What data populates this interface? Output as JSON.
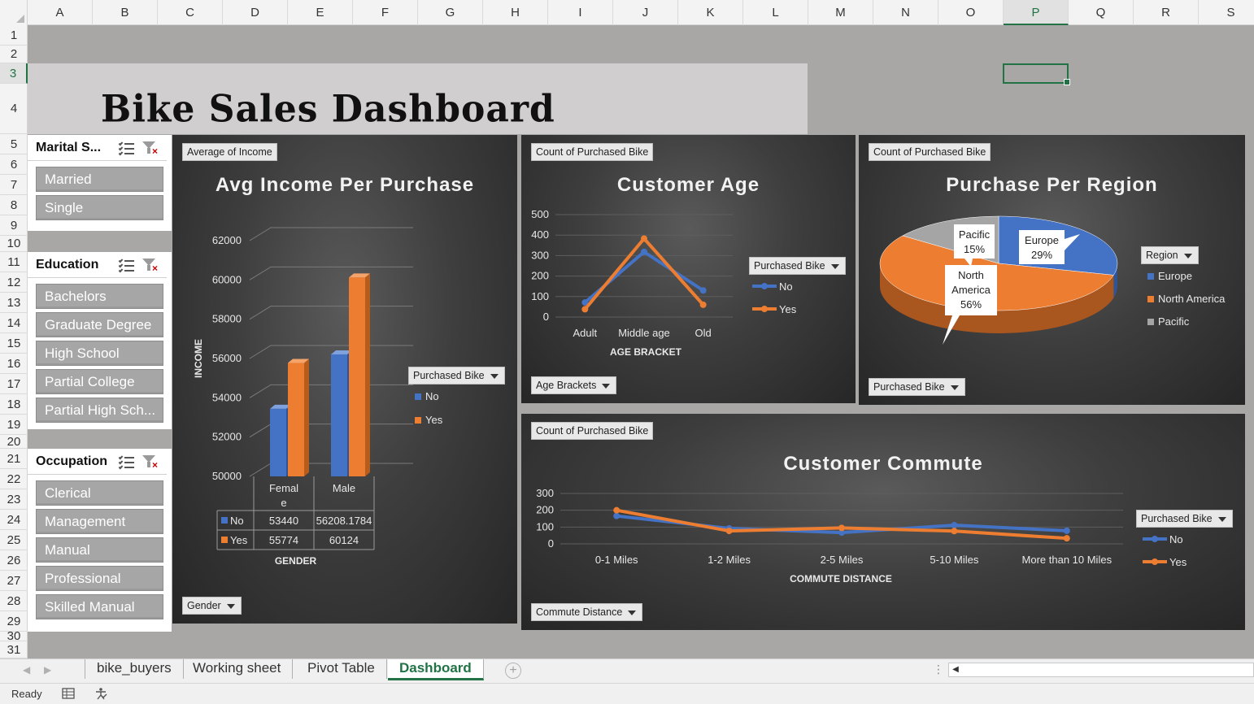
{
  "columns": [
    "A",
    "B",
    "C",
    "D",
    "E",
    "F",
    "G",
    "H",
    "I",
    "J",
    "K",
    "L",
    "M",
    "N",
    "O",
    "P",
    "Q",
    "R",
    "S"
  ],
  "active_column": "P",
  "rows": [
    "1",
    "2",
    "3",
    "4",
    "5",
    "6",
    "7",
    "8",
    "9",
    "10",
    "11",
    "12",
    "13",
    "14",
    "15",
    "16",
    "17",
    "18",
    "19",
    "20",
    "21",
    "22",
    "23",
    "24",
    "25",
    "26",
    "27",
    "28",
    "29",
    "30",
    "31"
  ],
  "active_row": "3",
  "dashboard_title": "Bike Sales Dashboard",
  "slicers": {
    "marital": {
      "title": "Marital S...",
      "items": [
        "Married",
        "Single"
      ]
    },
    "education": {
      "title": "Education",
      "items": [
        "Bachelors",
        "Graduate Degree",
        "High School",
        "Partial College",
        "Partial High Sch..."
      ]
    },
    "occupation": {
      "title": "Occupation",
      "items": [
        "Clerical",
        "Management",
        "Manual",
        "Professional",
        "Skilled Manual"
      ]
    }
  },
  "income_chart": {
    "value_button": "Average of Income",
    "axis_button": "Gender",
    "legend_button": "Purchased Bike",
    "title": "Avg Income Per Purchase",
    "ylabel": "INCOME",
    "xlabel": "GENDER",
    "yticks": [
      "62000",
      "60000",
      "58000",
      "56000",
      "54000",
      "52000",
      "50000"
    ],
    "legend": [
      "No",
      "Yes"
    ],
    "table": {
      "headers": [
        "Femal­e",
        "Male"
      ],
      "header_lines": [
        [
          "Femal",
          "e"
        ],
        [
          "Male"
        ]
      ],
      "rows": [
        {
          "label": "No",
          "values": [
            "53440",
            "56208.1784"
          ]
        },
        {
          "label": "Yes",
          "values": [
            "55774",
            "60124"
          ]
        }
      ]
    }
  },
  "age_chart": {
    "value_button": "Count of Purchased Bike",
    "axis_button": "Age Brackets",
    "legend_button": "Purchased Bike",
    "title": "Customer Age",
    "xlabel": "AGE BRACKET",
    "yticks": [
      "500",
      "400",
      "300",
      "200",
      "100",
      "0"
    ],
    "legend": [
      "No",
      "Yes"
    ]
  },
  "region_chart": {
    "value_button": "Count of Purchased Bike",
    "axis_button": "Purchased Bike",
    "legend_button": "Region",
    "title": "Purchase Per Region",
    "legend": [
      "Europe",
      "North America",
      "Pacific"
    ],
    "labels": {
      "europe": [
        "Europe",
        "29%"
      ],
      "north_america": [
        "North",
        "America",
        "56%"
      ],
      "pacific": [
        "Pacific",
        "15%"
      ]
    }
  },
  "commute_chart": {
    "value_button": "Count of Purchased Bike",
    "axis_button": "Commute Distance",
    "legend_button": "Purchased Bike",
    "title": "Customer Commute",
    "xlabel": "COMMUTE DISTANCE",
    "yticks": [
      "300",
      "200",
      "100",
      "0"
    ],
    "legend": [
      "No",
      "Yes"
    ]
  },
  "chart_data": [
    {
      "type": "bar",
      "title": "Avg Income Per Purchase",
      "xlabel": "GENDER",
      "ylabel": "INCOME",
      "categories": [
        "Female",
        "Male"
      ],
      "ylim": [
        50000,
        62000
      ],
      "series": [
        {
          "name": "No",
          "values": [
            53440,
            56208.1784
          ]
        },
        {
          "name": "Yes",
          "values": [
            55774,
            60124
          ]
        }
      ]
    },
    {
      "type": "line",
      "title": "Customer Age",
      "xlabel": "AGE BRACKET",
      "categories": [
        "Adult",
        "Middle age",
        "Old"
      ],
      "ylim": [
        0,
        500
      ],
      "series": [
        {
          "name": "No",
          "values": [
            71,
            318,
            130
          ]
        },
        {
          "name": "Yes",
          "values": [
            38,
            383,
            60
          ]
        }
      ]
    },
    {
      "type": "pie",
      "title": "Purchase Per Region",
      "categories": [
        "Europe",
        "North America",
        "Pacific"
      ],
      "values": [
        29,
        56,
        15
      ]
    },
    {
      "type": "line",
      "title": "Customer Commute",
      "xlabel": "COMMUTE DISTANCE",
      "categories": [
        "0-1 Miles",
        "1-2 Miles",
        "2-5 Miles",
        "5-10 Miles",
        "More than 10 Miles"
      ],
      "ylim": [
        0,
        300
      ],
      "series": [
        {
          "name": "No",
          "values": [
            166,
            92,
            67,
            111,
            78
          ]
        },
        {
          "name": "Yes",
          "values": [
            200,
            77,
            95,
            76,
            33
          ]
        }
      ]
    }
  ],
  "colors": {
    "no": "#4472c4",
    "yes": "#ed7d31",
    "pacific": "#a5a5a5",
    "excel_green": "#217346"
  },
  "sheet_tabs": [
    "bike_buyers",
    "Working sheet",
    "Pivot Table",
    "Dashboard"
  ],
  "active_tab": "Dashboard",
  "status": "Ready",
  "icons": {
    "add_sheet": "plus-circle-icon",
    "cell_mode": "table-icon",
    "accessibility": "accessibility-check-icon"
  }
}
